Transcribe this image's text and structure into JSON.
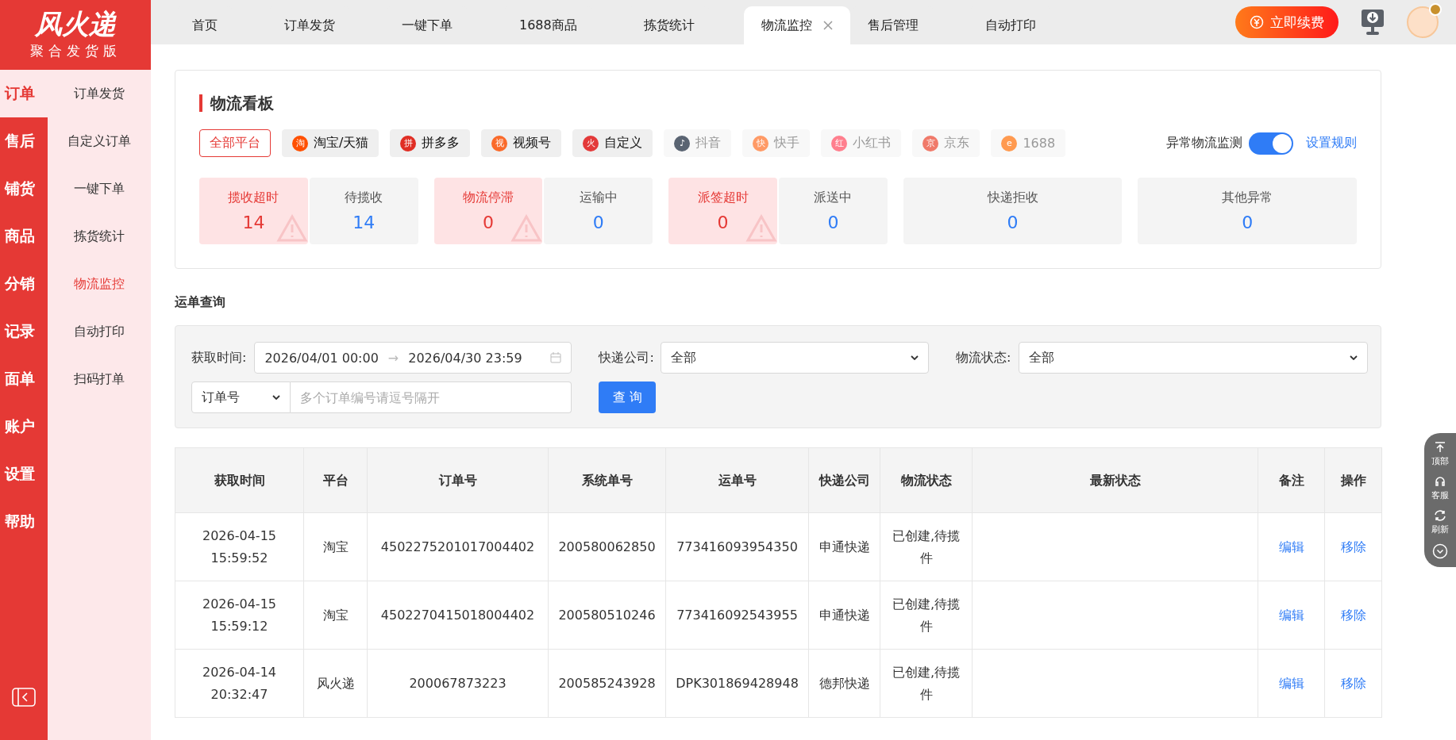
{
  "logo": {
    "name": "风火递",
    "subtitle": "聚合发货版"
  },
  "rail": [
    {
      "label": "订单",
      "selected": true
    },
    {
      "label": "售后",
      "selected": false
    },
    {
      "label": "铺货",
      "selected": false
    },
    {
      "label": "商品",
      "selected": false
    },
    {
      "label": "分销",
      "selected": false
    },
    {
      "label": "记录",
      "selected": false
    },
    {
      "label": "面单",
      "selected": false
    },
    {
      "label": "账户",
      "selected": false
    },
    {
      "label": "设置",
      "selected": false
    },
    {
      "label": "帮助",
      "selected": false
    }
  ],
  "submenu": [
    {
      "label": "订单发货",
      "selected": false
    },
    {
      "label": "自定义订单",
      "selected": false
    },
    {
      "label": "一键下单",
      "selected": false
    },
    {
      "label": "拣货统计",
      "selected": false
    },
    {
      "label": "物流监控",
      "selected": true
    },
    {
      "label": "自动打印",
      "selected": false
    },
    {
      "label": "扫码打单",
      "selected": false
    }
  ],
  "tabs": [
    {
      "label": "首页",
      "selected": false
    },
    {
      "label": "订单发货",
      "selected": false
    },
    {
      "label": "一键下单",
      "selected": false
    },
    {
      "label": "1688商品",
      "selected": false
    },
    {
      "label": "拣货统计",
      "selected": false
    },
    {
      "label": "物流监控",
      "selected": true
    },
    {
      "label": "售后管理",
      "selected": false
    },
    {
      "label": "自动打印",
      "selected": false
    }
  ],
  "renew_button": "立即续费",
  "board": {
    "title": "物流看板",
    "platforms": [
      {
        "label": "全部平台",
        "selected": true,
        "disabled": false
      },
      {
        "label": "淘宝/天猫",
        "selected": false,
        "disabled": false,
        "color": "#ff5000",
        "glyph": "淘"
      },
      {
        "label": "拼多多",
        "selected": false,
        "disabled": false,
        "color": "#e02e24",
        "glyph": "拼"
      },
      {
        "label": "视频号",
        "selected": false,
        "disabled": false,
        "color": "#fa6a2a",
        "glyph": "视"
      },
      {
        "label": "自定义",
        "selected": false,
        "disabled": false,
        "color": "#e33a3a",
        "glyph": "火"
      },
      {
        "label": "抖音",
        "selected": false,
        "disabled": true,
        "color": "#5a6472",
        "glyph": "♪"
      },
      {
        "label": "快手",
        "selected": false,
        "disabled": true,
        "color": "#ff9a66",
        "glyph": "快"
      },
      {
        "label": "小红书",
        "selected": false,
        "disabled": true,
        "color": "#ff7f8e",
        "glyph": "红"
      },
      {
        "label": "京东",
        "selected": false,
        "disabled": true,
        "color": "#f07a6a",
        "glyph": "京"
      },
      {
        "label": "1688",
        "selected": false,
        "disabled": true,
        "color": "#ff9a50",
        "glyph": "e"
      }
    ],
    "monitor": {
      "label": "异常物流监测",
      "on": true
    },
    "rules_link": "设置规则",
    "stat_groups": [
      [
        {
          "label": "揽收超时",
          "value": "14",
          "kind": "alert"
        },
        {
          "label": "待揽收",
          "value": "14",
          "kind": "normal"
        }
      ],
      [
        {
          "label": "物流停滞",
          "value": "0",
          "kind": "alert"
        },
        {
          "label": "运输中",
          "value": "0",
          "kind": "normal"
        }
      ],
      [
        {
          "label": "派签超时",
          "value": "0",
          "kind": "alert"
        },
        {
          "label": "派送中",
          "value": "0",
          "kind": "normal"
        }
      ],
      [
        {
          "label": "快递拒收",
          "value": "0",
          "kind": "normal"
        }
      ],
      [
        {
          "label": "其他异常",
          "value": "0",
          "kind": "normal"
        }
      ]
    ]
  },
  "query": {
    "title": "运单查询",
    "time_label": "获取时间:",
    "start": "2026/04/01 00:00",
    "range_separator": "→",
    "end": "2026/04/30 23:59",
    "company_label": "快递公司:",
    "company_value": "全部",
    "status_label": "物流状态:",
    "status_value": "全部",
    "id_type": "订单号",
    "id_placeholder": "多个订单编号请逗号隔开",
    "search_button": "查 询"
  },
  "table": {
    "columns": [
      "获取时间",
      "平台",
      "订单号",
      "系统单号",
      "运单号",
      "快递公司",
      "物流状态",
      "最新状态",
      "备注",
      "操作"
    ],
    "rows": [
      {
        "time": "2026-04-15 15:59:52",
        "platform": "淘宝",
        "order_no": "4502275201017004402",
        "system_no": "200580062850",
        "waybill_no": "773416093954350",
        "courier": "申通快递",
        "status": "已创建,待揽件",
        "note_link": "编辑",
        "action_link": "移除"
      },
      {
        "time": "2026-04-15 15:59:12",
        "platform": "淘宝",
        "order_no": "4502270415018004402",
        "system_no": "200580510246",
        "waybill_no": "773416092543955",
        "courier": "申通快递",
        "status": "已创建,待揽件",
        "note_link": "编辑",
        "action_link": "移除"
      },
      {
        "time": "2026-04-14 20:32:47",
        "platform": "风火递",
        "order_no": "200067873223",
        "system_no": "200585243928",
        "waybill_no": "DPK301869428948",
        "courier": "德邦快递",
        "status": "已创建,待揽件",
        "note_link": "编辑",
        "action_link": "移除"
      }
    ]
  },
  "float_panel": [
    {
      "label": "顶部",
      "kind": "top"
    },
    {
      "label": "客服",
      "kind": "service"
    },
    {
      "label": "刷新",
      "kind": "refresh"
    },
    {
      "kind": "down"
    }
  ]
}
